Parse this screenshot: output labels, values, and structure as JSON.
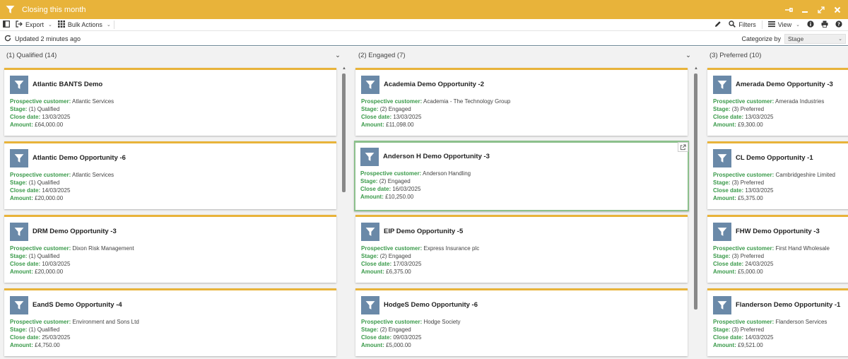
{
  "window": {
    "title": "Closing this month"
  },
  "toolbar": {
    "export_label": "Export",
    "bulk_label": "Bulk Actions",
    "filters_label": "Filters",
    "view_label": "View"
  },
  "status": {
    "updated": "Updated 2 minutes ago",
    "categorize_label": "Categorize by",
    "categorize_value": "Stage"
  },
  "field_labels": {
    "customer": "Prospective customer:",
    "stage": "Stage:",
    "close": "Close date:",
    "amount": "Amount:"
  },
  "columns": [
    {
      "header": "(1) Qualified (14)",
      "cards": [
        {
          "name": "Atlantic BANTS Demo",
          "customer": "Atlantic Services",
          "stage": "(1) Qualified",
          "close": "13/03/2025",
          "amount": "£64,000.00"
        },
        {
          "name": "Atlantic Demo Opportunity -6",
          "customer": "Atlantic Services",
          "stage": "(1) Qualified",
          "close": "14/03/2025",
          "amount": "£20,000.00"
        },
        {
          "name": "DRM Demo Opportunity -3",
          "customer": "Dixon Risk Management",
          "stage": "(1) Qualified",
          "close": "10/03/2025",
          "amount": "£20,000.00"
        },
        {
          "name": "EandS Demo Opportunity -4",
          "customer": "Environment and Sons Ltd",
          "stage": "(1) Qualified",
          "close": "25/03/2025",
          "amount": "£4,750.00"
        }
      ]
    },
    {
      "header": "(2) Engaged (7)",
      "cards": [
        {
          "name": "Academia Demo Opportunity -2",
          "customer": "Academia - The Technology Group",
          "stage": "(2) Engaged",
          "close": "13/03/2025",
          "amount": "£11,098.00"
        },
        {
          "name": "Anderson H Demo Opportunity -3",
          "customer": "Anderson Handling",
          "stage": "(2) Engaged",
          "close": "16/03/2025",
          "amount": "£10,250.00"
        },
        {
          "name": "EIP Demo Opportunity -5",
          "customer": "Express Insurance plc",
          "stage": "(2) Engaged",
          "close": "17/03/2025",
          "amount": "£6,375.00"
        },
        {
          "name": "HodgeS Demo Opportunity -6",
          "customer": "Hodge Society",
          "stage": "(2) Engaged",
          "close": "09/03/2025",
          "amount": "£5,000.00"
        }
      ]
    },
    {
      "header": "(3) Preferred (10)",
      "cards": [
        {
          "name": "Amerada Demo Opportunity -3",
          "customer": "Amerada Industries",
          "stage": "(3) Preferred",
          "close": "13/03/2025",
          "amount": "£9,300.00"
        },
        {
          "name": "CL Demo Opportunity -1",
          "customer": "Cambridgeshire Limited",
          "stage": "(3) Preferred",
          "close": "13/03/2025",
          "amount": "£5,375.00"
        },
        {
          "name": "FHW Demo Opportunity -3",
          "customer": "First Hand Wholesale",
          "stage": "(3) Preferred",
          "close": "24/03/2025",
          "amount": "£5,000.00"
        },
        {
          "name": "Flanderson Demo Opportunity -1",
          "customer": "Flanderson Services",
          "stage": "(3) Preferred",
          "close": "14/03/2025",
          "amount": "£9,521.00"
        }
      ]
    }
  ],
  "colors": {
    "accent": "#e8b33a",
    "label_green": "#3a9a4a",
    "avatar_blue": "#6a89a8",
    "highlight": "#8cc08c"
  },
  "icons": [
    "funnel-icon",
    "pin-icon",
    "minimize-icon",
    "expand-icon",
    "close-icon",
    "panel-icon",
    "export-icon",
    "grid-icon",
    "pencil-icon",
    "search-icon",
    "list-icon",
    "info-icon",
    "print-icon",
    "help-icon",
    "refresh-icon",
    "external-link-icon"
  ]
}
